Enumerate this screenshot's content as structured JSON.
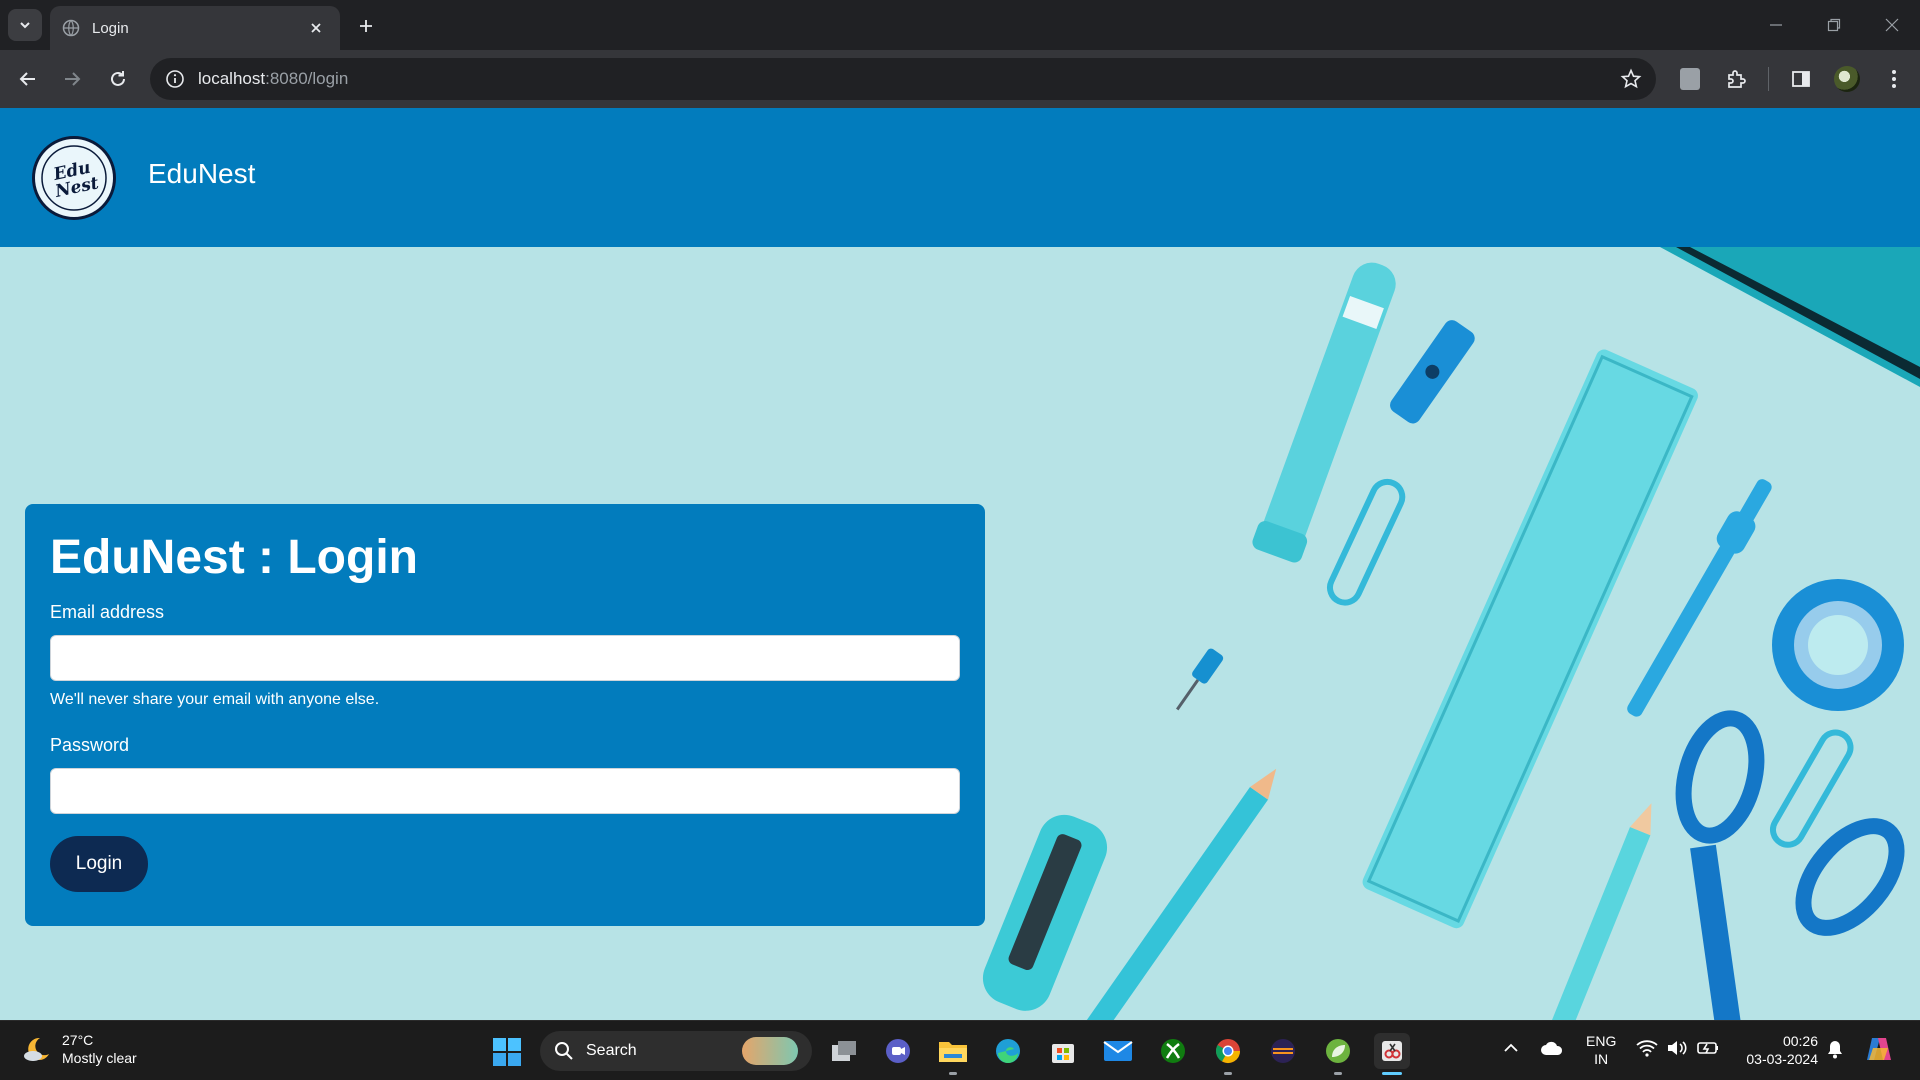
{
  "browser": {
    "tab_title": "Login",
    "url_host": "localhost",
    "url_path": ":8080/login"
  },
  "navbar": {
    "brand": "EduNest",
    "logo_text": "Edu Nest"
  },
  "login_card": {
    "title": "EduNest : Login",
    "email_label": "Email address",
    "email_value": "",
    "email_help": "We'll never share your email with anyone else.",
    "password_label": "Password",
    "password_value": "",
    "submit_label": "Login"
  },
  "taskbar": {
    "weather_temp": "27°C",
    "weather_desc": "Mostly clear",
    "search_label": "Search",
    "lang_line1": "ENG",
    "lang_line2": "IN",
    "time": "00:26",
    "date": "03-03-2024"
  },
  "colors": {
    "navbar": "#027cbd",
    "card": "#027cbd",
    "button": "#0d2a52",
    "background": "#b7e3e6"
  }
}
